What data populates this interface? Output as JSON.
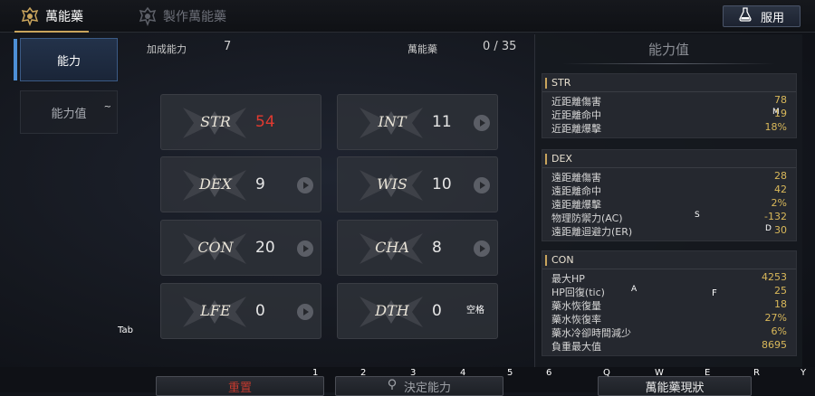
{
  "tabs": [
    {
      "label": "萬能藥",
      "icon": "potion-crest-icon",
      "active": true
    },
    {
      "label": "製作萬能藥",
      "icon": "craft-crest-icon",
      "active": false
    }
  ],
  "use_button": {
    "label": "服用",
    "icon": "flask-icon"
  },
  "sidebar": [
    {
      "label": "能力",
      "active": true,
      "key": ""
    },
    {
      "label": "能力值",
      "active": false,
      "key": "~"
    }
  ],
  "bonus": {
    "label": "加成能力",
    "value": "7"
  },
  "elixir": {
    "label": "萬能藥",
    "value": "0 / 35"
  },
  "stats": [
    {
      "name": "STR",
      "value": "54",
      "highlight": true,
      "key": ""
    },
    {
      "name": "INT",
      "value": "11",
      "highlight": false,
      "key": ""
    },
    {
      "name": "DEX",
      "value": "9",
      "highlight": false,
      "key": ""
    },
    {
      "name": "WIS",
      "value": "10",
      "highlight": false,
      "key": ""
    },
    {
      "name": "CON",
      "value": "20",
      "highlight": false,
      "key": ""
    },
    {
      "name": "CHA",
      "value": "8",
      "highlight": false,
      "key": ""
    },
    {
      "name": "LFE",
      "value": "0",
      "highlight": false,
      "key": ""
    },
    {
      "name": "DTH",
      "value": "0",
      "highlight": false,
      "key": "空格"
    }
  ],
  "panel": {
    "title": "能力值",
    "sections": [
      {
        "name": "STR",
        "rows": [
          {
            "label": "近距離傷害",
            "value": "78",
            "key": ""
          },
          {
            "label": "近距離命中",
            "value": "19",
            "key": "M"
          },
          {
            "label": "近距離爆擊",
            "value": "18%",
            "key": ""
          }
        ]
      },
      {
        "name": "DEX",
        "rows": [
          {
            "label": "遠距離傷害",
            "value": "28",
            "key": ""
          },
          {
            "label": "遠距離命中",
            "value": "42",
            "key": ""
          },
          {
            "label": "遠距離爆擊",
            "value": "2%",
            "key": ""
          },
          {
            "label": "物理防禦力(AC)",
            "value": "-132",
            "key": "S"
          },
          {
            "label": "遠距離迴避力(ER)",
            "value": "30",
            "key": "D"
          }
        ]
      },
      {
        "name": "CON",
        "rows": [
          {
            "label": "最大HP",
            "value": "4253",
            "key": ""
          },
          {
            "label": "HP回復(tic)",
            "value": "25",
            "key": "A"
          },
          {
            "label": "藥水恢復量",
            "value": "18",
            "key": ""
          },
          {
            "label": "藥水恢復率",
            "value": "27%",
            "key": ""
          },
          {
            "label": "藥水冷卻時間減少",
            "value": "6%",
            "key": ""
          },
          {
            "label": "負重最大值",
            "value": "8695",
            "key": ""
          }
        ]
      }
    ],
    "extra_key": "F"
  },
  "bottom": {
    "btn1": "重置",
    "btn2": "決定能力",
    "btn3": "萬能藥現狀",
    "tab_key": "Tab",
    "hotkeys": [
      "1",
      "2",
      "3",
      "4",
      "5",
      "6",
      "Q",
      "W",
      "E",
      "R",
      "Y"
    ]
  }
}
